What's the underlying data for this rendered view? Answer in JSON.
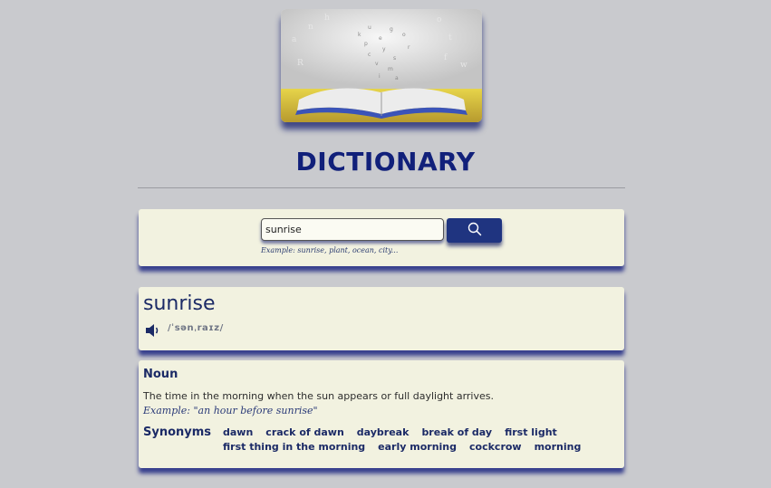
{
  "header": {
    "title": "DICTIONARY",
    "hero_image": "open-book-with-floating-letters"
  },
  "search": {
    "value": "sunrise",
    "hint": "Example: sunrise, plant, ocean, city...",
    "button_icon": "search-icon"
  },
  "entry": {
    "word": "sunrise",
    "phonetic": "/ˈsənˌraɪz/",
    "audio_icon": "speaker-icon"
  },
  "meaning": {
    "part_of_speech": "Noun",
    "definition": "The time in the morning when the sun appears or full daylight arrives.",
    "example": "Example: \"an hour before sunrise\"",
    "synonyms_label": "Synonyms",
    "synonyms_row1": [
      "dawn",
      "crack of dawn",
      "daybreak",
      "break of day",
      "first light"
    ],
    "synonyms_row2": [
      "first thing in the morning",
      "early morning",
      "cockcrow",
      "morning"
    ]
  },
  "colors": {
    "page_bg": "#c9cace",
    "card_bg": "#f2f2e0",
    "accent": "#1f3480",
    "title": "#11207a"
  }
}
